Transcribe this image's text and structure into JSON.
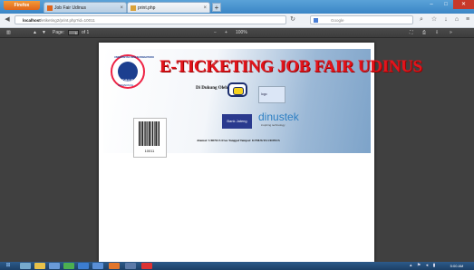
{
  "browser": {
    "firefox_label": "Firefox",
    "tabs": [
      {
        "label": "Job Fair Udinus",
        "close": "×"
      },
      {
        "label": "print.php",
        "close": "×"
      }
    ],
    "new_tab": "+",
    "window_controls": {
      "min": "–",
      "max": "□",
      "close": "✕"
    },
    "url_host": "localhost",
    "url_path": "/etiketing2/print.php?id=10011",
    "search_placeholder": "Google",
    "nav_icons": [
      "back-icon",
      "reload-icon",
      "bookmark-icon",
      "home-icon",
      "download-icon"
    ]
  },
  "pdf_toolbar": {
    "page_label": "Page:",
    "page_value": "1",
    "page_total": "of 1",
    "zoom_minus": "−",
    "zoom_plus": "+",
    "zoom_value": "100%"
  },
  "ticket": {
    "title": "E-TICKETING JOB FAIR UDINUS",
    "logo_top": "UNIVERSITAS DIAN NUSWANTORO",
    "logo_mid": "UDINUS",
    "logo_bottom": "SEMARANG",
    "supported_by": "Di Dukung Oleh :",
    "sponsor_logo_2": "logo",
    "bank_label": "Bank Jateng",
    "dinustek_label": "dinustek",
    "dinustek_sub": "inspiring technology",
    "barcode_number": "10011",
    "address": "Alamat: UDINUS Free Tanggal Tempat: KTM/KTA UDINUS"
  },
  "taskbar": {
    "clock": "5:00 AM"
  },
  "colors": {
    "title_red": "#e4141c",
    "udinus_blue": "#1c3f8f",
    "firefox_orange": "#e0651b"
  }
}
